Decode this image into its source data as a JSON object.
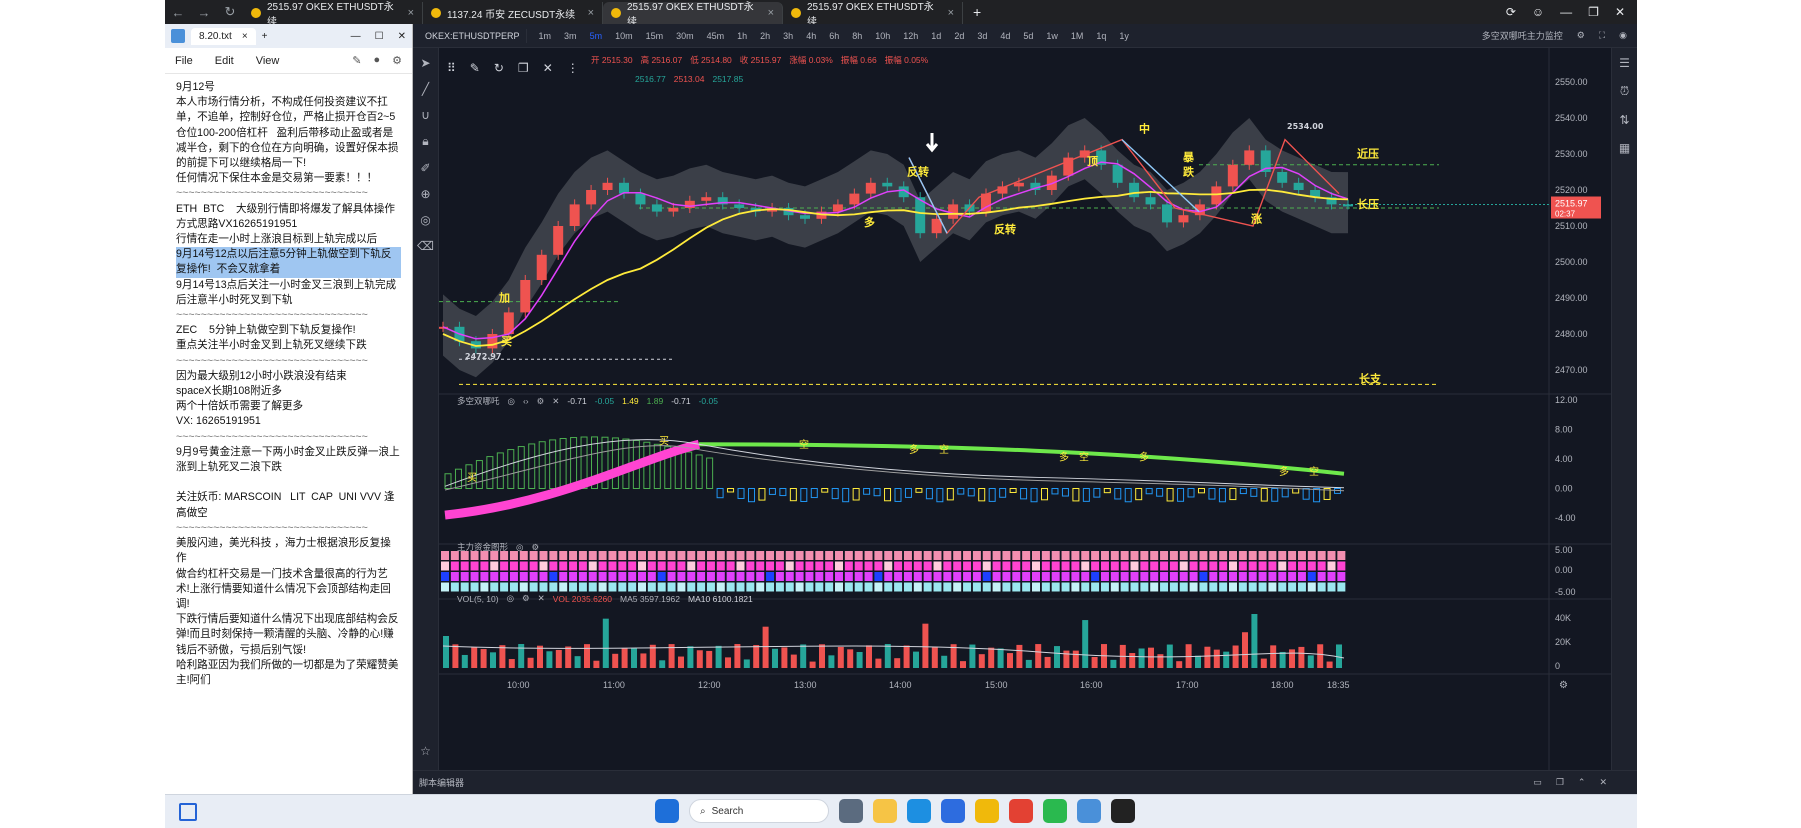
{
  "browser": {
    "tabs": [
      {
        "title": "2515.97 OKEX ETHUSDT永续",
        "active": false
      },
      {
        "title": "1137.24 币安 ZECUSDT永续",
        "active": false
      },
      {
        "title": "2515.97 OKEX ETHUSDT永续",
        "active": true
      },
      {
        "title": "2515.97 OKEX ETHUSDT永续",
        "active": false
      }
    ]
  },
  "notepad": {
    "tab_title": "8.20.txt",
    "menu": [
      "File",
      "Edit",
      "View"
    ],
    "lines": [
      {
        "text": "9月12号",
        "hl": false
      },
      {
        "text": "本人市场行情分析，不构成任何投资建议不扛单，不追单，控制好仓位，严格止损开仓百2~5仓位100-200倍杠杆   盈利后带移动止盈或者是减半仓，剩下的仓位在方向明确，设置好保本损的前提下可以继续格局一下!",
        "hl": false
      },
      {
        "text": "任何情况下保住本金是交易第一要素！！！",
        "hl": false
      },
      {
        "text": "~~~~~~~~~~~~~~~~~~~~~~~~~~~~~~~",
        "hl": false,
        "sep": true
      },
      {
        "text": "ETH  BTC    大级别行情即将爆发了解具体操作方式思路VX16265191951",
        "hl": false
      },
      {
        "text": "行情在走一小时上涨浪目标到上轨完成以后",
        "hl": false
      },
      {
        "text": "9月14号12点以后注意5分钟上轨做空到下轨反复操作!  不会又就拿着",
        "hl": true
      },
      {
        "text": "9月14号13点后关注一小时金叉三浪到上轨完成后注意半小时死叉到下轨",
        "hl": false
      },
      {
        "text": "~~~~~~~~~~~~~~~~~~~~~~~~~~~~~~~",
        "hl": false,
        "sep": true
      },
      {
        "text": "ZEC    5分钟上轨做空到下轨反复操作!",
        "hl": false
      },
      {
        "text": "重点关注半小时金叉到上轨死叉继续下跌",
        "hl": false
      },
      {
        "text": "~~~~~~~~~~~~~~~~~~~~~~~~~~~~~~~",
        "hl": false,
        "sep": true
      },
      {
        "text": "因为最大级别12小时小跌浪没有结束",
        "hl": false
      },
      {
        "text": "spaceX长期108附近多",
        "hl": false
      },
      {
        "text": "两个十倍妖币需要了解更多",
        "hl": false
      },
      {
        "text": "VX: 16265191951",
        "hl": false
      },
      {
        "text": "~~~~~~~~~~~~~~~~~~~~~~~~~~~~~~~",
        "hl": false,
        "sep": true
      },
      {
        "text": "9月9号黄金注意一下两小时金叉止跌反弹一浪上涨到上轨死叉二浪下跌",
        "hl": false
      },
      {
        "text": "",
        "hl": false
      },
      {
        "text": "关注妖币: MARSCOIN   LIT  CAP  UNI VVV 逢高做空",
        "hl": false
      },
      {
        "text": "~~~~~~~~~~~~~~~~~~~~~~~~~~~~~~~",
        "hl": false,
        "sep": true
      },
      {
        "text": "美股闪迪，美光科技 ，海力士根据浪形反复操作",
        "hl": false
      },
      {
        "text": "做合约杠杆交易是一门技术含量很高的行为艺术!上涨行情要知道什么情况下会顶部结构走回调!",
        "hl": false
      },
      {
        "text": "下跌行情后要知道什么情况下出现底部结构会反弹!而且时刻保持一颗清醒的头脑、冷静的心!赚钱后不骄傲，亏损后别气馁!",
        "hl": false
      },
      {
        "text": "哈利路亚因为我们所做的一切都是为了荣耀赞美主!阿们",
        "hl": false
      }
    ]
  },
  "tv": {
    "symbol": "OKEX:ETHUSDTPERP",
    "timeframes": [
      "1m",
      "3m",
      "5m",
      "10m",
      "15m",
      "30m",
      "45m",
      "1h",
      "2h",
      "3h",
      "4h",
      "6h",
      "8h",
      "10h",
      "12h",
      "1d",
      "2d",
      "3d",
      "4d",
      "5d",
      "1w",
      "1M",
      "1q",
      "1y"
    ],
    "active_tf": "5m",
    "indicator_label": "多空双哪吒主力监控",
    "ohlc": {
      "o": "开 2515.30",
      "h": "高 2516.07",
      "l": "低 2514.80",
      "c": "收 2515.97",
      "chg": "涨幅 0.03%",
      "amp": "振幅 0.66",
      "amp_pct": "振幅 0.05%"
    },
    "ind1": {
      "v1": "2516.77",
      "v2": "2513.04",
      "v3": "2517.85"
    },
    "ind2": {
      "name": "多空双哪吒",
      "values": [
        "-0.71",
        "-0.05",
        "1.49",
        "1.89",
        "-0.71",
        "-0.05"
      ]
    },
    "ind3": {
      "name": "主力资金图形"
    },
    "vol": {
      "name": "VOL(5, 10)",
      "vol": "VOL 2035.6260",
      "ma5": "MA5 3597.1962",
      "ma10": "MA10 6100.1821"
    },
    "price_ticks": [
      "2550.00",
      "2540.00",
      "2530.00",
      "2520.00",
      "2510.00",
      "2500.00",
      "2490.00",
      "2480.00",
      "2470.00"
    ],
    "osc_ticks": [
      "12.00",
      "8.00",
      "4.00",
      "0.00",
      "-4.00"
    ],
    "flow_ticks": [
      "5.00",
      "0.00",
      "-5.00"
    ],
    "vol_ticks": [
      "40K",
      "20K",
      "0"
    ],
    "time_ticks": [
      "10:00",
      "11:00",
      "12:00",
      "13:00",
      "14:00",
      "15:00",
      "16:00",
      "17:00",
      "18:00",
      "18:35"
    ],
    "last_price": "2515.97",
    "countdown": "02:37",
    "annotations": {
      "high_label": "2534.00",
      "low_label": "2472.97",
      "fanzhuan1": "反转",
      "fanzhuan2": "反转",
      "ding": "顶",
      "bao": "暴",
      "die": "跌",
      "zhang": "涨",
      "duo": "多",
      "kong": "空",
      "jinya": "近压",
      "changzhi": "长支",
      "changya": "长压",
      "jia": "加",
      "zhong": "中",
      "mai": "买"
    },
    "bottom_label": "脚本编辑器"
  },
  "chart_data": {
    "type": "candlestick",
    "symbol": "OKEX:ETHUSDTPERP",
    "interval": "5m",
    "ylim": [
      2465,
      2555
    ],
    "x": [
      "10:00",
      "11:00",
      "12:00",
      "13:00",
      "14:00",
      "15:00",
      "16:00",
      "17:00",
      "18:00",
      "18:35"
    ],
    "close_path": [
      2482,
      2478,
      2476,
      2480,
      2486,
      2495,
      2502,
      2510,
      2516,
      2520,
      2522,
      2519,
      2516,
      2514,
      2515,
      2517,
      2518,
      2516,
      2515,
      2514,
      2515,
      2513,
      2512,
      2514,
      2516,
      2519,
      2522,
      2521,
      2518,
      2508,
      2512,
      2516,
      2514,
      2519,
      2521,
      2522,
      2520,
      2524,
      2529,
      2531,
      2527,
      2522,
      2518,
      2516,
      2511,
      2513,
      2516,
      2521,
      2527,
      2531,
      2525,
      2522,
      2520,
      2518,
      2516,
      2515.97
    ],
    "last_price": 2515.97,
    "high_marker": 2534.0,
    "low_marker": 2472.97
  }
}
